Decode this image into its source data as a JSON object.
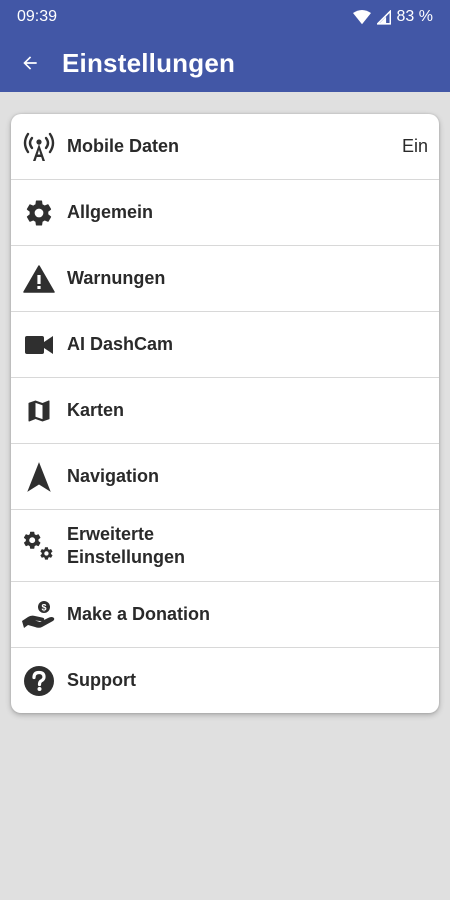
{
  "status": {
    "time": "09:39",
    "battery": "83 %"
  },
  "appbar": {
    "title": "Einstellungen"
  },
  "menu": [
    {
      "label": "Mobile Daten",
      "value": "Ein",
      "icon": "antenna-icon"
    },
    {
      "label": "Allgemein",
      "icon": "gear-icon"
    },
    {
      "label": "Warnungen",
      "icon": "warning-icon"
    },
    {
      "label": "AI DashCam",
      "icon": "video-camera-icon"
    },
    {
      "label": "Karten",
      "icon": "map-icon"
    },
    {
      "label": "Navigation",
      "icon": "navigation-arrow-icon"
    },
    {
      "label": "Erweiterte Einstellungen",
      "icon": "gears-icon"
    },
    {
      "label": "Make a Donation",
      "icon": "donation-hand-icon"
    },
    {
      "label": "Support",
      "icon": "help-icon"
    }
  ],
  "colors": {
    "primary": "#4257a6",
    "background": "#e0e0e0",
    "card": "#ffffff",
    "text": "#2a2a2a"
  }
}
